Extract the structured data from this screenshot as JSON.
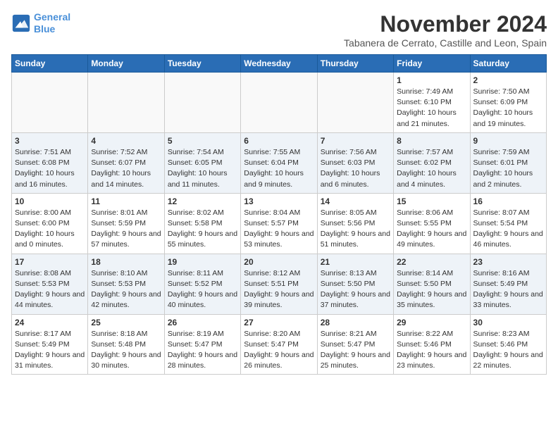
{
  "logo": {
    "line1": "General",
    "line2": "Blue"
  },
  "title": "November 2024",
  "subtitle": "Tabanera de Cerrato, Castille and Leon, Spain",
  "weekdays": [
    "Sunday",
    "Monday",
    "Tuesday",
    "Wednesday",
    "Thursday",
    "Friday",
    "Saturday"
  ],
  "weeks": [
    [
      {
        "day": "",
        "info": ""
      },
      {
        "day": "",
        "info": ""
      },
      {
        "day": "",
        "info": ""
      },
      {
        "day": "",
        "info": ""
      },
      {
        "day": "",
        "info": ""
      },
      {
        "day": "1",
        "info": "Sunrise: 7:49 AM\nSunset: 6:10 PM\nDaylight: 10 hours and 21 minutes."
      },
      {
        "day": "2",
        "info": "Sunrise: 7:50 AM\nSunset: 6:09 PM\nDaylight: 10 hours and 19 minutes."
      }
    ],
    [
      {
        "day": "3",
        "info": "Sunrise: 7:51 AM\nSunset: 6:08 PM\nDaylight: 10 hours and 16 minutes."
      },
      {
        "day": "4",
        "info": "Sunrise: 7:52 AM\nSunset: 6:07 PM\nDaylight: 10 hours and 14 minutes."
      },
      {
        "day": "5",
        "info": "Sunrise: 7:54 AM\nSunset: 6:05 PM\nDaylight: 10 hours and 11 minutes."
      },
      {
        "day": "6",
        "info": "Sunrise: 7:55 AM\nSunset: 6:04 PM\nDaylight: 10 hours and 9 minutes."
      },
      {
        "day": "7",
        "info": "Sunrise: 7:56 AM\nSunset: 6:03 PM\nDaylight: 10 hours and 6 minutes."
      },
      {
        "day": "8",
        "info": "Sunrise: 7:57 AM\nSunset: 6:02 PM\nDaylight: 10 hours and 4 minutes."
      },
      {
        "day": "9",
        "info": "Sunrise: 7:59 AM\nSunset: 6:01 PM\nDaylight: 10 hours and 2 minutes."
      }
    ],
    [
      {
        "day": "10",
        "info": "Sunrise: 8:00 AM\nSunset: 6:00 PM\nDaylight: 10 hours and 0 minutes."
      },
      {
        "day": "11",
        "info": "Sunrise: 8:01 AM\nSunset: 5:59 PM\nDaylight: 9 hours and 57 minutes."
      },
      {
        "day": "12",
        "info": "Sunrise: 8:02 AM\nSunset: 5:58 PM\nDaylight: 9 hours and 55 minutes."
      },
      {
        "day": "13",
        "info": "Sunrise: 8:04 AM\nSunset: 5:57 PM\nDaylight: 9 hours and 53 minutes."
      },
      {
        "day": "14",
        "info": "Sunrise: 8:05 AM\nSunset: 5:56 PM\nDaylight: 9 hours and 51 minutes."
      },
      {
        "day": "15",
        "info": "Sunrise: 8:06 AM\nSunset: 5:55 PM\nDaylight: 9 hours and 49 minutes."
      },
      {
        "day": "16",
        "info": "Sunrise: 8:07 AM\nSunset: 5:54 PM\nDaylight: 9 hours and 46 minutes."
      }
    ],
    [
      {
        "day": "17",
        "info": "Sunrise: 8:08 AM\nSunset: 5:53 PM\nDaylight: 9 hours and 44 minutes."
      },
      {
        "day": "18",
        "info": "Sunrise: 8:10 AM\nSunset: 5:53 PM\nDaylight: 9 hours and 42 minutes."
      },
      {
        "day": "19",
        "info": "Sunrise: 8:11 AM\nSunset: 5:52 PM\nDaylight: 9 hours and 40 minutes."
      },
      {
        "day": "20",
        "info": "Sunrise: 8:12 AM\nSunset: 5:51 PM\nDaylight: 9 hours and 39 minutes."
      },
      {
        "day": "21",
        "info": "Sunrise: 8:13 AM\nSunset: 5:50 PM\nDaylight: 9 hours and 37 minutes."
      },
      {
        "day": "22",
        "info": "Sunrise: 8:14 AM\nSunset: 5:50 PM\nDaylight: 9 hours and 35 minutes."
      },
      {
        "day": "23",
        "info": "Sunrise: 8:16 AM\nSunset: 5:49 PM\nDaylight: 9 hours and 33 minutes."
      }
    ],
    [
      {
        "day": "24",
        "info": "Sunrise: 8:17 AM\nSunset: 5:49 PM\nDaylight: 9 hours and 31 minutes."
      },
      {
        "day": "25",
        "info": "Sunrise: 8:18 AM\nSunset: 5:48 PM\nDaylight: 9 hours and 30 minutes."
      },
      {
        "day": "26",
        "info": "Sunrise: 8:19 AM\nSunset: 5:47 PM\nDaylight: 9 hours and 28 minutes."
      },
      {
        "day": "27",
        "info": "Sunrise: 8:20 AM\nSunset: 5:47 PM\nDaylight: 9 hours and 26 minutes."
      },
      {
        "day": "28",
        "info": "Sunrise: 8:21 AM\nSunset: 5:47 PM\nDaylight: 9 hours and 25 minutes."
      },
      {
        "day": "29",
        "info": "Sunrise: 8:22 AM\nSunset: 5:46 PM\nDaylight: 9 hours and 23 minutes."
      },
      {
        "day": "30",
        "info": "Sunrise: 8:23 AM\nSunset: 5:46 PM\nDaylight: 9 hours and 22 minutes."
      }
    ]
  ]
}
